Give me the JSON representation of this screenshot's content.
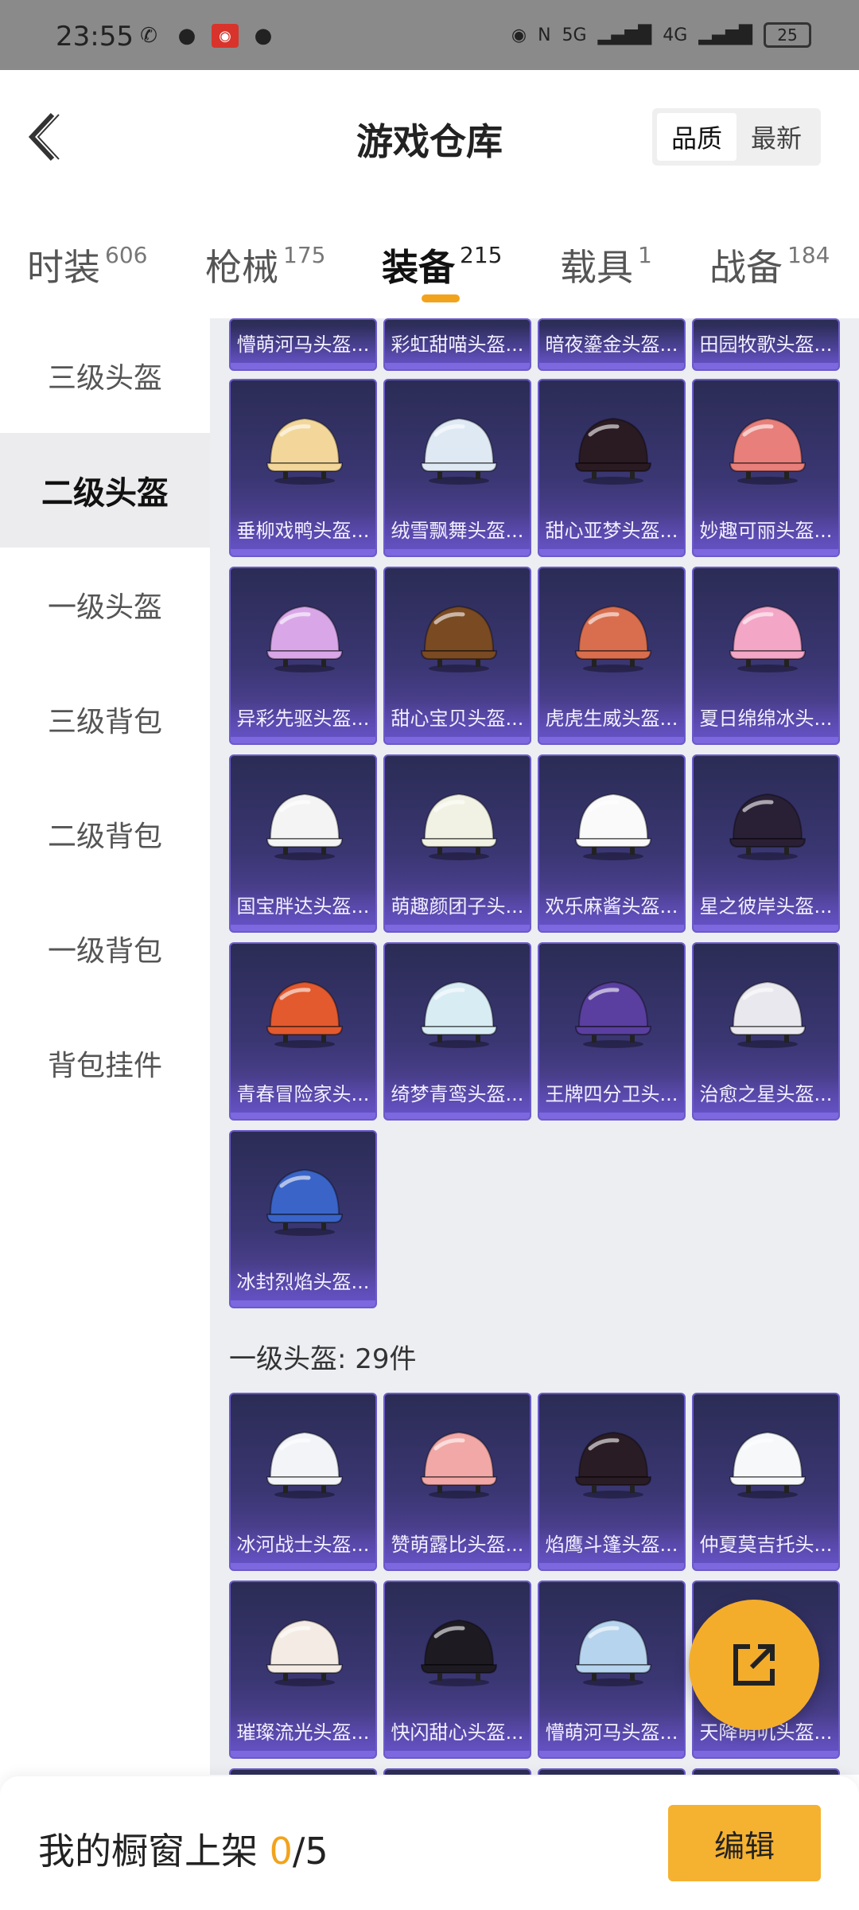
{
  "status_bar": {
    "time": "23:55",
    "battery": "25",
    "network_1": "5G",
    "network_2": "4G"
  },
  "header": {
    "title": "游戏仓库",
    "sort_options": [
      "品质",
      "最新"
    ],
    "sort_selected": "品质"
  },
  "tabs": [
    {
      "label": "时装",
      "count": "606"
    },
    {
      "label": "枪械",
      "count": "175"
    },
    {
      "label": "装备",
      "count": "215",
      "active": true
    },
    {
      "label": "载具",
      "count": "1"
    },
    {
      "label": "战备",
      "count": "184"
    }
  ],
  "sidebar": {
    "items": [
      "三级头盔",
      "二级头盔",
      "一级头盔",
      "三级背包",
      "二级背包",
      "一级背包",
      "背包挂件"
    ],
    "active": "二级头盔"
  },
  "content": {
    "top_partial_items": [
      "懵萌河马头盔...",
      "彩虹甜喵头盔...",
      "暗夜鎏金头盔...",
      "田园牧歌头盔..."
    ],
    "level2_items": [
      {
        "name": "垂柳戏鸭头盔...",
        "color": "#f3d79a"
      },
      {
        "name": "绒雪飘舞头盔...",
        "color": "#dfe9f4"
      },
      {
        "name": "甜心亚梦头盔...",
        "color": "#2a1a22"
      },
      {
        "name": "妙趣可丽头盔...",
        "color": "#e87f7a"
      },
      {
        "name": "异彩先驱头盔...",
        "color": "#d9a7e8"
      },
      {
        "name": "甜心宝贝头盔...",
        "color": "#7a4a22"
      },
      {
        "name": "虎虎生威头盔...",
        "color": "#d96e4e"
      },
      {
        "name": "夏日绵绵冰头...",
        "color": "#f3a6c6"
      },
      {
        "name": "国宝胖达头盔...",
        "color": "#f4f4f4"
      },
      {
        "name": "萌趣颜团子头...",
        "color": "#f2f2e4"
      },
      {
        "name": "欢乐麻酱头盔...",
        "color": "#fafafa"
      },
      {
        "name": "星之彼岸头盔...",
        "color": "#2a2036"
      },
      {
        "name": "青春冒险家头...",
        "color": "#e35a2e"
      },
      {
        "name": "绮梦青鸾头盔...",
        "color": "#d8ecf4"
      },
      {
        "name": "王牌四分卫头...",
        "color": "#5a3fa0"
      },
      {
        "name": "治愈之星头盔...",
        "color": "#e8e8ee"
      },
      {
        "name": "冰封烈焰头盔...",
        "color": "#3a64c8"
      }
    ],
    "level1_title": "一级头盔: 29件",
    "level1_items": [
      {
        "name": "冰河战士头盔...",
        "color": "#f2f4f8"
      },
      {
        "name": "赞萌露比头盔...",
        "color": "#f2a8a6"
      },
      {
        "name": "焰鹰斗篷头盔...",
        "color": "#2a1c24"
      },
      {
        "name": "仲夏莫吉托头...",
        "color": "#f6f8fa"
      },
      {
        "name": "璀璨流光头盔...",
        "color": "#f4ece4"
      },
      {
        "name": "快闪甜心头盔...",
        "color": "#1e1a22"
      },
      {
        "name": "懵萌河马头盔...",
        "color": "#b6d4ee"
      },
      {
        "name": "天降萌叽头盔...",
        "color": "#f0d6a4"
      }
    ]
  },
  "bottom_bar": {
    "shelf_label": "我的橱窗上架",
    "shelf_current": "0",
    "shelf_total": "/5",
    "edit_label": "编辑"
  },
  "colors": {
    "accent": "#f2a31c",
    "card_bg": "#3a3672",
    "card_border": "#6b5ac9"
  }
}
